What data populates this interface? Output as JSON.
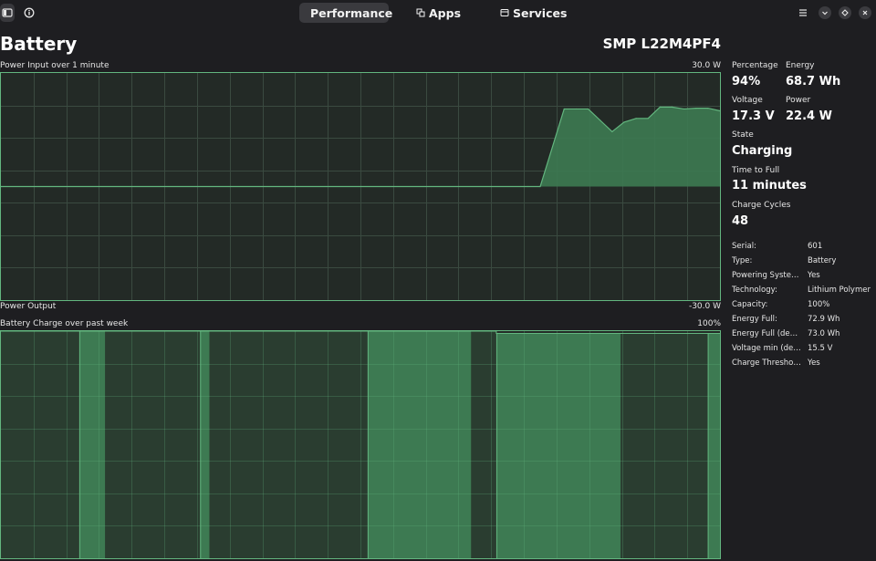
{
  "header": {
    "tabs": [
      {
        "label": "Performance",
        "icon": "gauge-icon",
        "active": true
      },
      {
        "label": "Apps",
        "icon": "apps-icon",
        "active": false
      },
      {
        "label": "Services",
        "icon": "services-icon",
        "active": false
      }
    ]
  },
  "page": {
    "title": "Battery",
    "model": "SMP L22M4PF4"
  },
  "power_graph": {
    "title": "Power Input over 1 minute",
    "max_label": "30.0 W",
    "bottom_title": "Power Output",
    "min_label": "-30.0 W"
  },
  "charge_graph": {
    "title": "Battery Charge over past week",
    "max_label": "100%"
  },
  "stats": {
    "percentage_label": "Percentage",
    "percentage_value": "94%",
    "energy_label": "Energy",
    "energy_value": "68.7 Wh",
    "voltage_label": "Voltage",
    "voltage_value": "17.3 V",
    "power_label": "Power",
    "power_value": "22.4 W",
    "state_label": "State",
    "state_value": "Charging",
    "time_label": "Time to Full",
    "time_value": "11 minutes",
    "cycles_label": "Charge Cycles",
    "cycles_value": "48"
  },
  "details": [
    {
      "key": "Serial:",
      "value": "601"
    },
    {
      "key": "Type:",
      "value": "Battery"
    },
    {
      "key": "Powering System:",
      "value": "Yes"
    },
    {
      "key": "Technology:",
      "value": "Lithium Polymer"
    },
    {
      "key": "Capacity:",
      "value": "100%"
    },
    {
      "key": "Energy Full:",
      "value": "72.9 Wh"
    },
    {
      "key": "Energy Full (design):",
      "value": "73.0 Wh"
    },
    {
      "key": "Voltage min (design):",
      "value": "15.5 V"
    },
    {
      "key": "Charge Threshold:",
      "value": "Yes"
    }
  ],
  "chart_data": [
    {
      "type": "area",
      "title": "Power Input over 1 minute",
      "ylim": [
        -30,
        30
      ],
      "x": [
        0,
        44,
        45,
        47,
        48,
        49,
        50,
        51,
        52,
        53,
        54,
        55,
        56,
        57,
        58,
        59,
        60
      ],
      "values": [
        0,
        0,
        0,
        20.5,
        20.5,
        20.5,
        17.5,
        14.5,
        17.0,
        18.0,
        18.0,
        21.0,
        21.0,
        20.5,
        20.7,
        20.7,
        20.0
      ],
      "grid": true,
      "colors": {
        "line": "#63b67f",
        "fill": "#3d7a52",
        "background": "#232a26",
        "grid": "#3a4a40"
      }
    },
    {
      "type": "area",
      "title": "Battery Charge over past week",
      "ylim": [
        0,
        100
      ],
      "grid": true,
      "regions": [
        {
          "from": 0,
          "to": 0.109,
          "value": 100,
          "shade": "dark"
        },
        {
          "from": 0.109,
          "to": 0.145,
          "value": 100,
          "shade": "light"
        },
        {
          "from": 0.145,
          "to": 0.277,
          "value": 100,
          "shade": "dark"
        },
        {
          "from": 0.277,
          "to": 0.29,
          "value": 100,
          "shade": "light"
        },
        {
          "from": 0.29,
          "to": 0.51,
          "value": 100,
          "shade": "dark"
        },
        {
          "from": 0.51,
          "to": 0.654,
          "value": 100,
          "shade": "light"
        },
        {
          "from": 0.654,
          "to": 0.689,
          "value": 100,
          "shade": "dark"
        },
        {
          "from": 0.689,
          "to": 0.862,
          "value": 99,
          "shade": "light"
        },
        {
          "from": 0.862,
          "to": 0.983,
          "value": 99,
          "shade": "dark"
        },
        {
          "from": 0.983,
          "to": 1.0,
          "value": 99,
          "shade": "light"
        }
      ],
      "colors": {
        "line": "#63b67f",
        "light": "#3d7a52",
        "dark": "#2a3d30"
      }
    }
  ]
}
